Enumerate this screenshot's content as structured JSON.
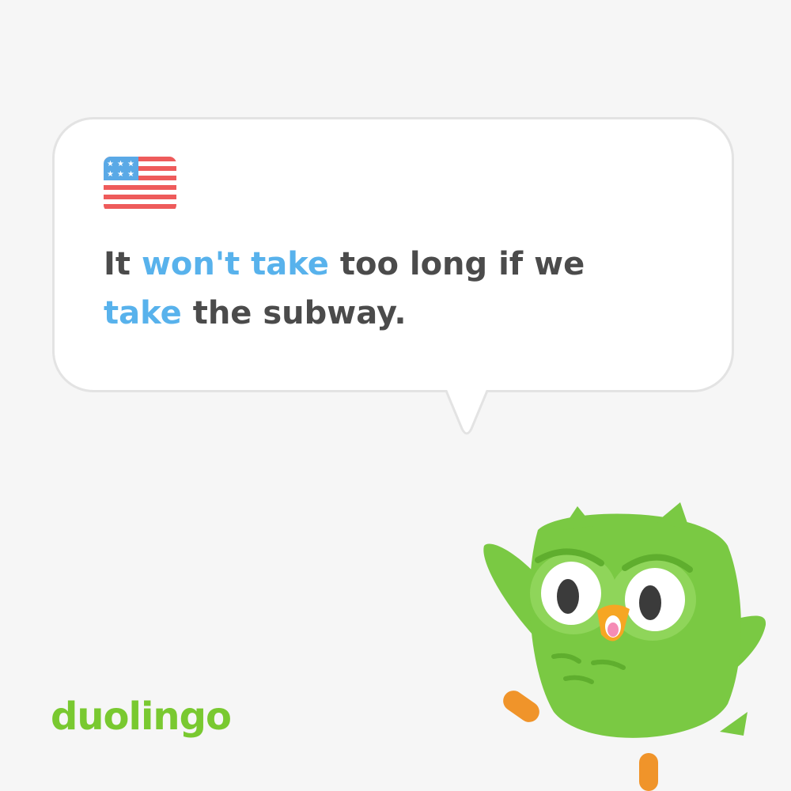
{
  "card": {
    "flag_icon": "us-flag-icon",
    "sentence": [
      {
        "text": "It ",
        "highlight": false
      },
      {
        "text": "won't take",
        "highlight": true
      },
      {
        "text": " too long if we ",
        "highlight": false
      },
      {
        "text": "take",
        "highlight": true
      },
      {
        "text": " the subway.",
        "highlight": false
      }
    ]
  },
  "brand": {
    "logo_text": "duolingo",
    "mascot_icon": "owl-mascot-icon"
  },
  "colors": {
    "background": "#f6f6f6",
    "text": "#4b4b4b",
    "highlight": "#58b2ec",
    "brand_green": "#79c930",
    "owl_green": "#7ac943"
  }
}
